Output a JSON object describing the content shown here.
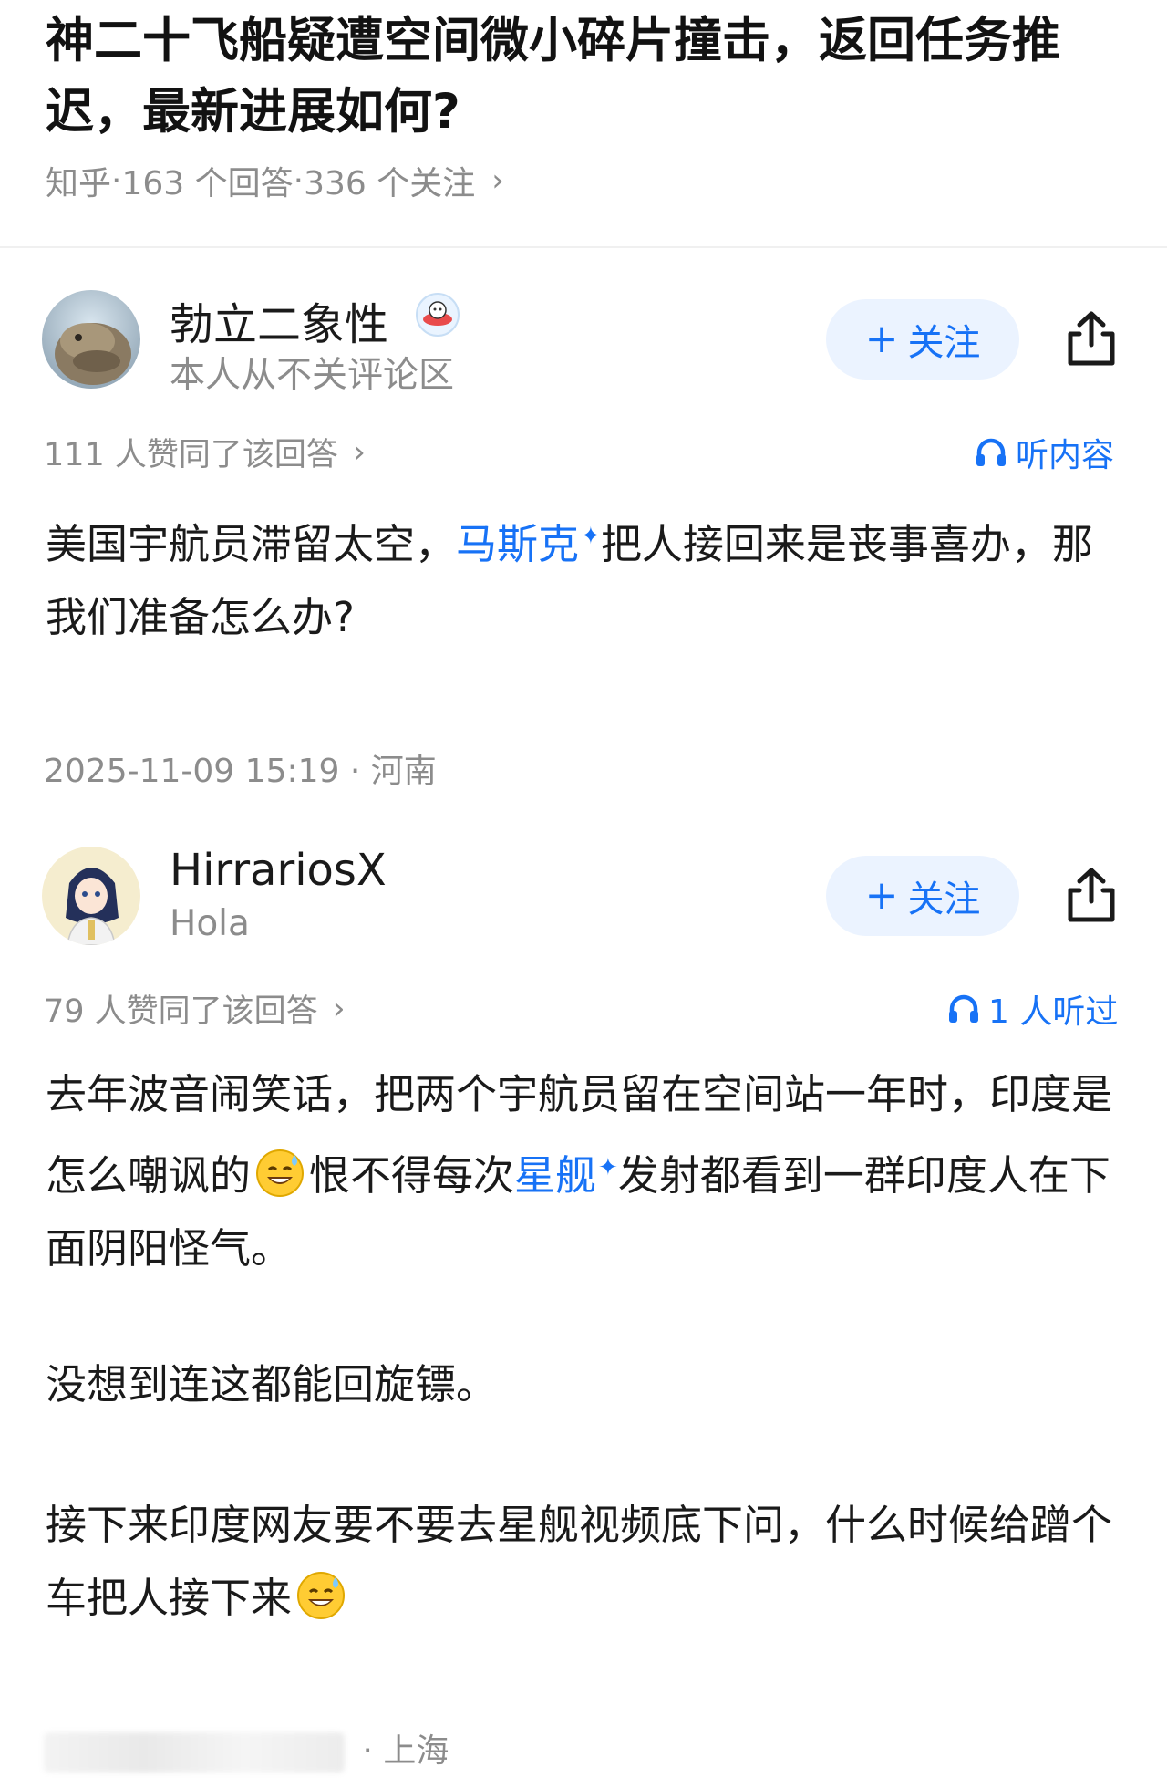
{
  "question": {
    "title": "神二十飞船疑遭空间微小碎片撞击，返回任务推迟，最新进展如何?",
    "source": "知乎",
    "answer_count": "163 个回答",
    "follow_count": "336 个关注",
    "separator": " · ",
    "chevron": "›"
  },
  "answers": [
    {
      "author_name": "勃立二象性",
      "author_bio": "本人从不关评论区",
      "follow_label": "关注",
      "agree_text": "111 人赞同了该回答",
      "listen_text": "听内容",
      "content_before_link": "美国宇航员滞留太空，",
      "link_text": "马斯克",
      "content_after_link": "把人接回来是丧事喜办，那我们准备怎么办?",
      "time": "2025-11-09 15:19",
      "location": "河南"
    },
    {
      "author_name": "HirrariosX",
      "author_bio": "Hola",
      "follow_label": "关注",
      "agree_text": "79 人赞同了该回答",
      "listen_text": "1 人听过",
      "para1_a": "去年波音闹笑话，把两个宇航员留在空间站一年时，印度是怎么嘲讽的",
      "para1_b": "恨不得每次",
      "link_text": "星舰",
      "para1_c": "发射都看到一群印度人在下面阴阳怪气。",
      "para2": "没想到连这都能回旋镖。",
      "para3": "接下来印度网友要不要去星舰视频底下问，什么时候给蹭个车把人接下来",
      "location": "上海"
    }
  ],
  "icons": {
    "share": "share-icon",
    "headphones": "headphones-icon",
    "emoji": "sweat-smile-emoji",
    "link_marker": "sparkle-icon"
  },
  "colors": {
    "accent": "#1772f6",
    "follow_bg": "#ebf3ff",
    "muted": "#8c8c8c"
  }
}
